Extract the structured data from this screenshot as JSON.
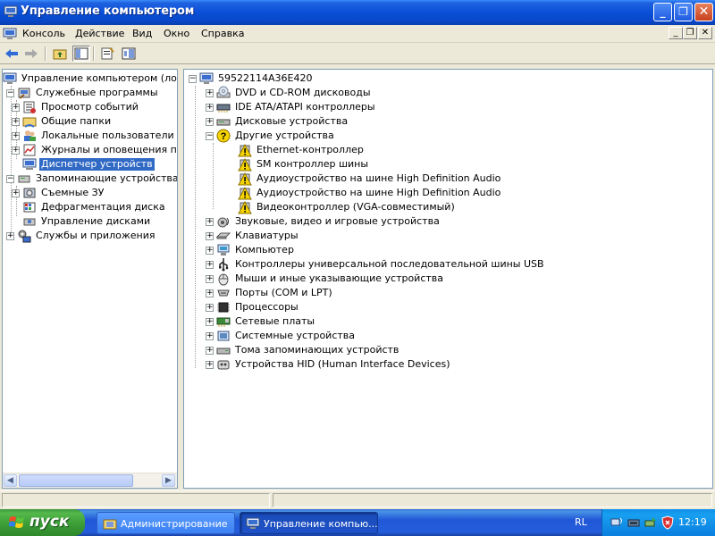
{
  "window": {
    "title": "Управление компьютером"
  },
  "menubar": {
    "items": [
      "Консоль",
      "Действие",
      "Вид",
      "Окно",
      "Справка"
    ]
  },
  "left_tree": {
    "root": "Управление компьютером (локальны",
    "items": [
      {
        "label": "Служебные программы",
        "level": 1,
        "expander": "minus",
        "icon": "tools-icon"
      },
      {
        "label": "Просмотр событий",
        "level": 2,
        "expander": "plus",
        "icon": "event-viewer-icon"
      },
      {
        "label": "Общие папки",
        "level": 2,
        "expander": "plus",
        "icon": "shared-folder-icon"
      },
      {
        "label": "Локальные пользователи и гр",
        "level": 2,
        "expander": "plus",
        "icon": "users-icon"
      },
      {
        "label": "Журналы и оповещения прои",
        "level": 2,
        "expander": "plus",
        "icon": "performance-logs-icon"
      },
      {
        "label": "Диспетчер устройств",
        "level": 2,
        "expander": "",
        "icon": "device-manager-icon",
        "selected": true
      },
      {
        "label": "Запоминающие устройства",
        "level": 1,
        "expander": "minus",
        "icon": "storage-icon"
      },
      {
        "label": "Съемные ЗУ",
        "level": 2,
        "expander": "plus",
        "icon": "removable-storage-icon"
      },
      {
        "label": "Дефрагментация диска",
        "level": 2,
        "expander": "",
        "icon": "defrag-icon"
      },
      {
        "label": "Управление дисками",
        "level": 2,
        "expander": "",
        "icon": "disk-management-icon"
      },
      {
        "label": "Службы и приложения",
        "level": 1,
        "expander": "plus",
        "icon": "services-icon"
      }
    ]
  },
  "device_tree": {
    "root": "59522114A36E420",
    "items": [
      {
        "label": "DVD и CD-ROM дисководы",
        "level": 1,
        "expander": "plus",
        "icon": "cdrom-icon"
      },
      {
        "label": "IDE ATA/ATAPI контроллеры",
        "level": 1,
        "expander": "plus",
        "icon": "ide-controller-icon"
      },
      {
        "label": "Дисковые устройства",
        "level": 1,
        "expander": "plus",
        "icon": "disk-drive-icon"
      },
      {
        "label": "Другие устройства",
        "level": 1,
        "expander": "minus",
        "icon": "unknown-device-icon"
      },
      {
        "label": "Ethernet-контроллер",
        "level": 2,
        "expander": "",
        "icon": "warning-device-icon"
      },
      {
        "label": "SM контроллер шины",
        "level": 2,
        "expander": "",
        "icon": "warning-device-icon"
      },
      {
        "label": "Аудиоустройство на шине High Definition Audio",
        "level": 2,
        "expander": "",
        "icon": "warning-device-icon"
      },
      {
        "label": "Аудиоустройство на шине High Definition Audio",
        "level": 2,
        "expander": "",
        "icon": "warning-device-icon"
      },
      {
        "label": "Видеоконтроллер (VGA-совместимый)",
        "level": 2,
        "expander": "",
        "icon": "warning-device-icon"
      },
      {
        "label": "Звуковые, видео и игровые устройства",
        "level": 1,
        "expander": "plus",
        "icon": "sound-icon"
      },
      {
        "label": "Клавиатуры",
        "level": 1,
        "expander": "plus",
        "icon": "keyboard-icon"
      },
      {
        "label": "Компьютер",
        "level": 1,
        "expander": "plus",
        "icon": "computer-icon"
      },
      {
        "label": "Контроллеры универсальной последовательной шины USB",
        "level": 1,
        "expander": "plus",
        "icon": "usb-icon"
      },
      {
        "label": "Мыши и иные указывающие устройства",
        "level": 1,
        "expander": "plus",
        "icon": "mouse-icon"
      },
      {
        "label": "Порты (COM и LPT)",
        "level": 1,
        "expander": "plus",
        "icon": "port-icon"
      },
      {
        "label": "Процессоры",
        "level": 1,
        "expander": "plus",
        "icon": "processor-icon"
      },
      {
        "label": "Сетевые платы",
        "level": 1,
        "expander": "plus",
        "icon": "network-card-icon"
      },
      {
        "label": "Системные устройства",
        "level": 1,
        "expander": "plus",
        "icon": "system-devices-icon"
      },
      {
        "label": "Тома запоминающих устройств",
        "level": 1,
        "expander": "plus",
        "icon": "storage-volume-icon"
      },
      {
        "label": "Устройства HID (Human Interface Devices)",
        "level": 1,
        "expander": "plus",
        "icon": "hid-icon"
      }
    ]
  },
  "taskbar": {
    "start_label": "пуск",
    "tasks": [
      {
        "label": "Администрирование",
        "active": false
      },
      {
        "label": "Управление компью...",
        "active": true
      }
    ],
    "language": "RL",
    "clock": "12:19"
  },
  "colors": {
    "selection": "#316ac5",
    "titlebar": "#0a4fd8",
    "taskbar": "#245edb",
    "start": "#3a9a35",
    "warning": "#f5d400"
  }
}
